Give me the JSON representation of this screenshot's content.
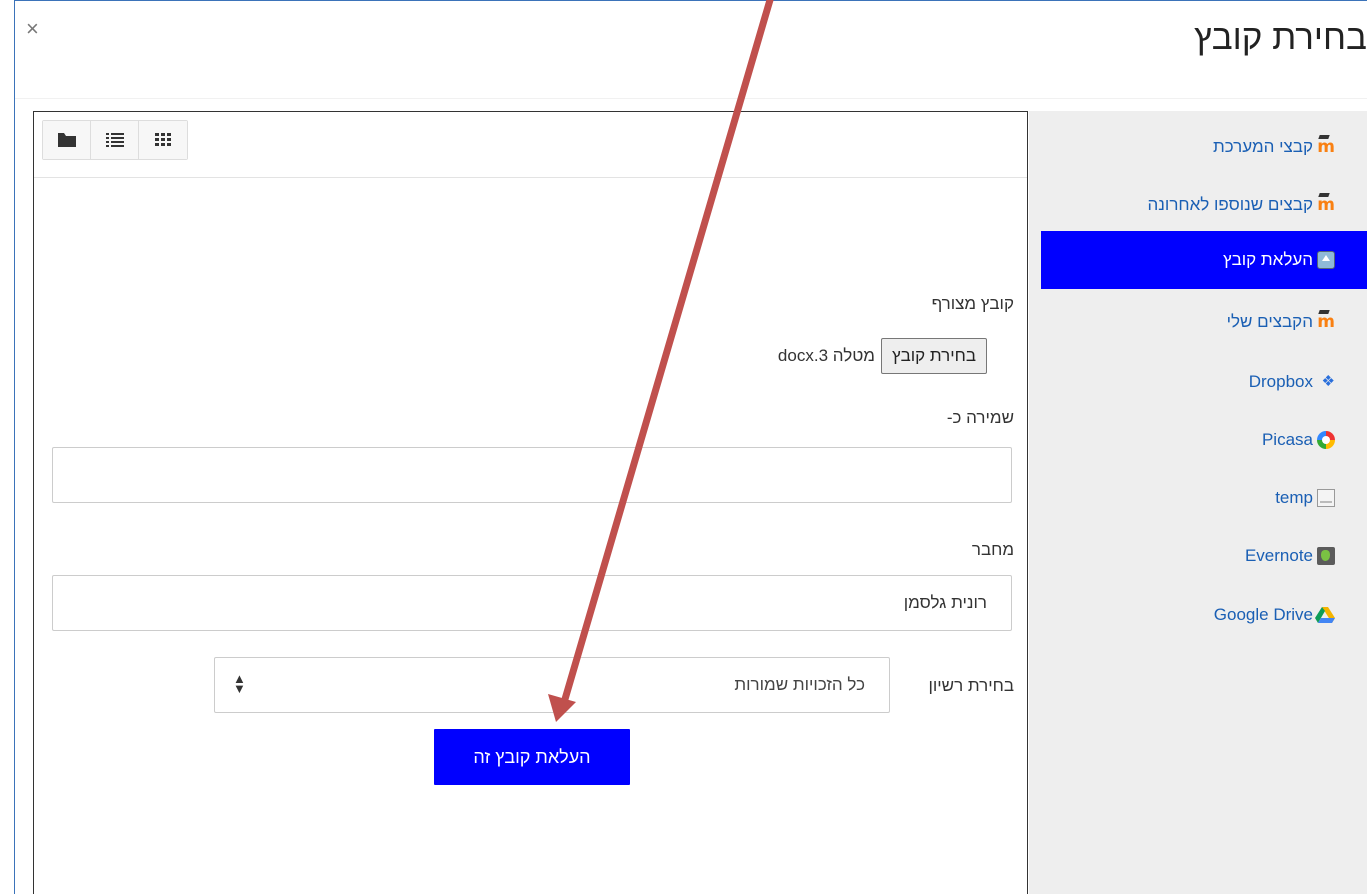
{
  "dialog": {
    "title": "בחירת קובץ",
    "close_glyph": "×"
  },
  "sidebar": {
    "items": [
      {
        "label": "קבצי המערכת",
        "icon": "moodle-icon"
      },
      {
        "label": "קבצים שנוספו לאחרונה",
        "icon": "moodle-icon"
      },
      {
        "label": "העלאת קובץ",
        "icon": "upload-icon",
        "active": true
      },
      {
        "label": "הקבצים שלי",
        "icon": "moodle-icon"
      },
      {
        "label": "Dropbox",
        "icon": "dropbox-icon"
      },
      {
        "label": "Picasa",
        "icon": "picasa-icon"
      },
      {
        "label": "temp",
        "icon": "temp-icon"
      },
      {
        "label": "Evernote",
        "icon": "evernote-icon"
      },
      {
        "label": "Google Drive",
        "icon": "google-drive-icon"
      }
    ]
  },
  "toolbar": {
    "views": [
      "folder-view-icon",
      "list-view-icon",
      "grid-view-icon"
    ]
  },
  "form": {
    "attachment_label": "קובץ מצורף",
    "choose_file_button": "בחירת קובץ",
    "chosen_file_name": "מטלה 3.docx",
    "save_as_label": "שמירה כ-",
    "save_as_value": "",
    "author_label": "מחבר",
    "author_value": "רונית גלסמן",
    "license_label": "בחירת רשיון",
    "license_value": "כל הזכויות שמורות",
    "submit_button": "העלאת קובץ זה"
  },
  "colors": {
    "accent": "#0000ff",
    "link": "#1a5fb4",
    "sidebar_bg": "#eeeeee",
    "annotation_arrow": "#c0504d"
  }
}
